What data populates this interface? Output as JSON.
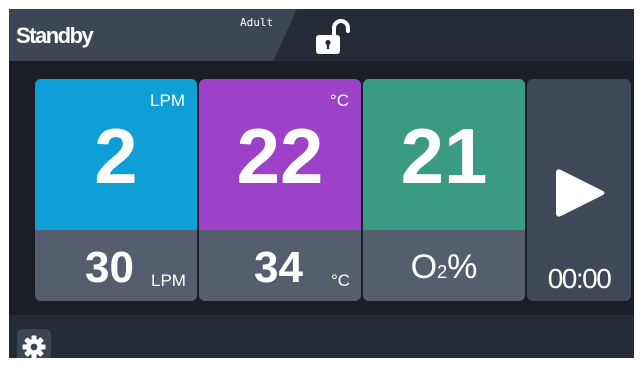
{
  "header": {
    "mode": "Standby",
    "patient_type": "Adult",
    "lock_icon": "unlocked-padlock-icon"
  },
  "tiles": [
    {
      "name": "flow",
      "unit": "LPM",
      "setpoint": "2",
      "actual": "30",
      "actual_unit": "LPM",
      "color": "#0e9fd6"
    },
    {
      "name": "temperature",
      "unit": "°C",
      "setpoint": "22",
      "actual": "34",
      "actual_unit": "°C",
      "color": "#9b42c9"
    },
    {
      "name": "oxygen",
      "setpoint": "21",
      "actual_label": "O",
      "actual_sub": "2",
      "actual_suffix": "%",
      "color": "#3a9b82"
    }
  ],
  "start": {
    "icon": "play-icon",
    "timer": "00:00"
  },
  "footer": {
    "settings_icon": "gear-icon"
  }
}
